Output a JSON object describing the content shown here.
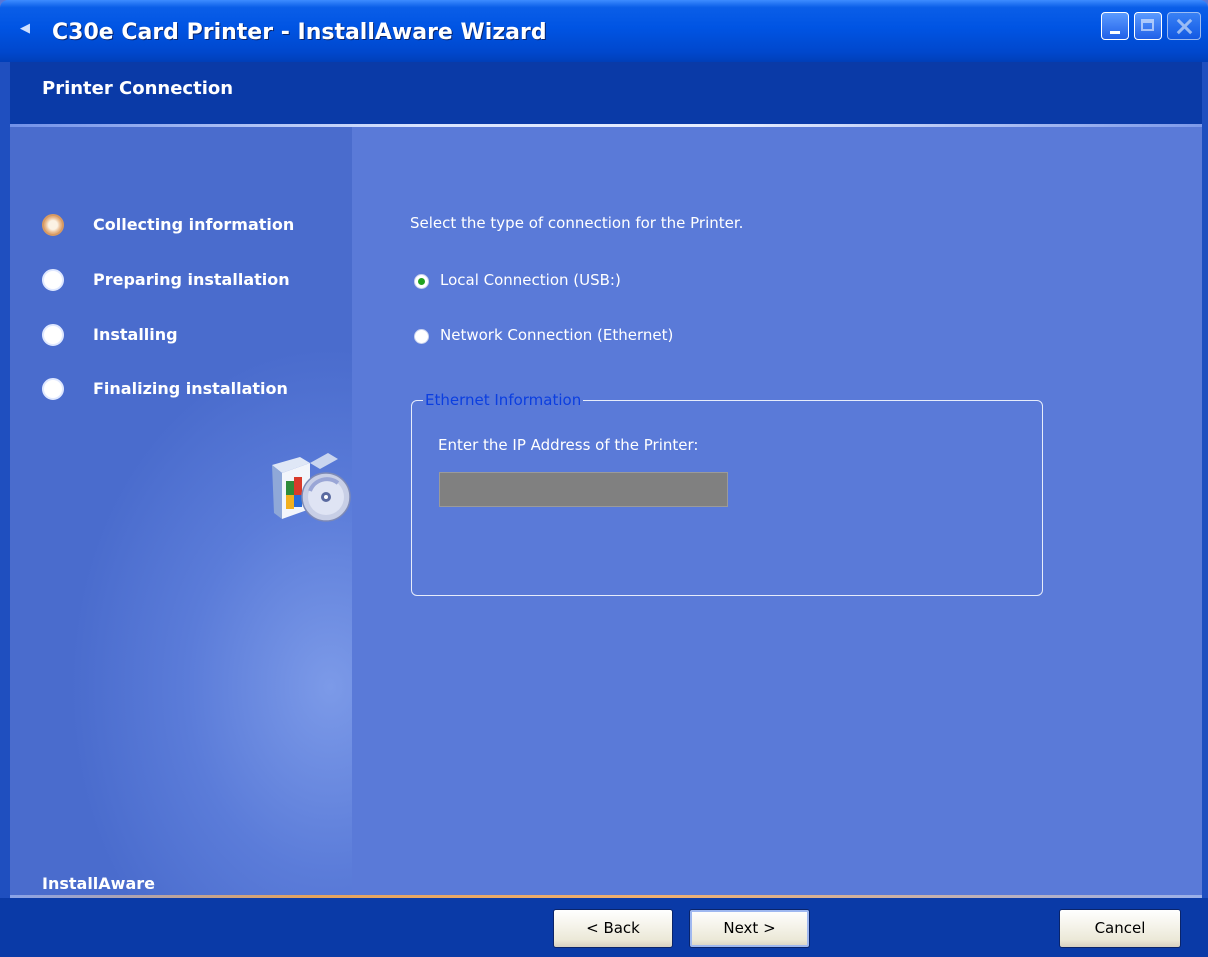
{
  "window": {
    "title": "C30e Card Printer - InstallAware Wizard"
  },
  "header": {
    "title": "Printer Connection"
  },
  "sidebar": {
    "steps": [
      {
        "label": "Collecting information",
        "state": "active"
      },
      {
        "label": "Preparing installation",
        "state": "pending"
      },
      {
        "label": "Installing",
        "state": "pending"
      },
      {
        "label": "Finalizing installation",
        "state": "pending"
      }
    ],
    "brand": "InstallAware"
  },
  "main": {
    "instruction": "Select the type of connection for the Printer.",
    "options": [
      {
        "label": "Local Connection (USB:)",
        "checked": true
      },
      {
        "label": "Network Connection (Ethernet)",
        "checked": false
      }
    ],
    "ethernet_group": {
      "title": "Ethernet Information",
      "ip_label": "Enter the IP Address of the Printer:",
      "ip_value": ""
    }
  },
  "footer": {
    "back_label": "< Back",
    "next_label": "Next >",
    "cancel_label": "Cancel"
  }
}
